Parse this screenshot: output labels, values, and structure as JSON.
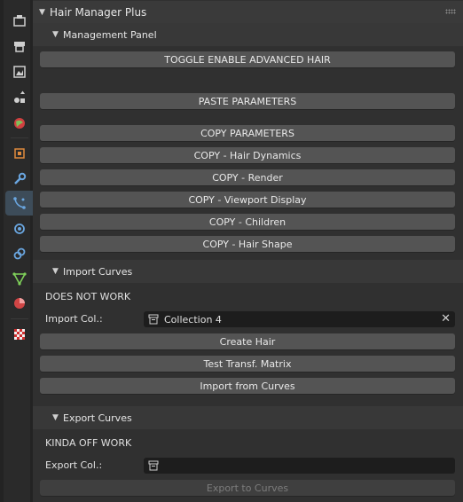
{
  "addon": {
    "title": "Hair Manager Plus"
  },
  "management": {
    "title": "Management Panel",
    "toggle_label": "TOGGLE ENABLE ADVANCED HAIR",
    "paste_label": "PASTE PARAMETERS",
    "copy_buttons": [
      "COPY PARAMETERS",
      "COPY - Hair Dynamics",
      "COPY - Render",
      "COPY - Viewport Display",
      "COPY - Children",
      "COPY - Hair Shape"
    ]
  },
  "import_curves": {
    "title": "Import Curves",
    "status": "DOES NOT WORK",
    "collection_label": "Import Col.:",
    "collection_value": "Collection 4",
    "create_hair_label": "Create Hair",
    "test_matrix_label": "Test Transf. Matrix",
    "import_from_curves_label": "Import from Curves"
  },
  "export_curves": {
    "title": "Export Curves",
    "status": "KINDA OFF WORK",
    "collection_label": "Export Col.:",
    "collection_value": "",
    "export_label": "Export to Curves"
  },
  "property_tabs": [
    {
      "icon": "tool-settings-icon",
      "active": false
    },
    {
      "icon": "render-properties-icon",
      "active": false
    },
    {
      "icon": "output-properties-icon",
      "active": false
    },
    {
      "icon": "view-layer-icon",
      "active": false
    },
    {
      "icon": "scene-properties-icon",
      "active": false
    },
    {
      "icon": "world-properties-icon",
      "active": false
    },
    {
      "icon": "object-properties-icon",
      "active": false
    },
    {
      "icon": "modifier-properties-icon",
      "active": false
    },
    {
      "icon": "particle-properties-icon",
      "active": true
    },
    {
      "icon": "physics-properties-icon",
      "active": false
    },
    {
      "icon": "constraint-properties-icon",
      "active": false
    },
    {
      "icon": "object-data-properties-icon",
      "active": false
    },
    {
      "icon": "material-properties-icon",
      "active": false
    },
    {
      "icon": "texture-properties-icon",
      "active": false
    }
  ],
  "colors": {
    "active_tab": "#3d4c59",
    "button": "#545454",
    "field": "#1d1d1d",
    "panel_header": "#383838"
  }
}
